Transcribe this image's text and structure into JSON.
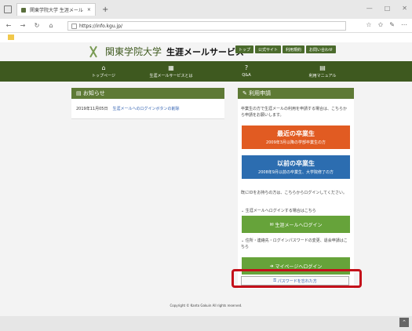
{
  "browser": {
    "tab_title": "関東学院大学 生涯メール",
    "new_tab": "+",
    "url": "https://info.kgu.jp/",
    "controls": [
      "—",
      "□",
      "✕"
    ],
    "right_icons": [
      "☆",
      "✩",
      "✎",
      "⋯"
    ]
  },
  "site": {
    "university": "関東学院大学",
    "service": "生涯メールサービス",
    "top_links": [
      "トップ",
      "公式サイト",
      "利用規約",
      "お問い合わせ"
    ]
  },
  "nav": [
    {
      "icon": "⌂",
      "label": "トップページ"
    },
    {
      "icon": "▦",
      "label": "生涯メールサービスとは"
    },
    {
      "icon": "?",
      "label": "Q&A"
    },
    {
      "icon": "▤",
      "label": "利用マニュアル"
    }
  ],
  "news": {
    "header": "お知らせ",
    "date": "2019年11月05日",
    "item": "生涯メールへのログインボタンの削除"
  },
  "apply": {
    "header": "利用申請",
    "intro": "卒業生の方で生涯メールの利用を申請する場合は、こちらから申請をお願いします。",
    "recent_title": "最近の卒業生",
    "recent_sub": "2009年3月以降の学部卒業生の方",
    "older_title": "以前の卒業生",
    "older_sub": "2008年9月以前の卒業生、大学院修了の方",
    "login_note": "既にIDをお持ちの方は、こちらからログインしてください。",
    "mail_disclosure": "生涯メールへログインする場合はこちら",
    "mail_login": "生涯メールへログイン",
    "mypage_disclosure": "住所・連絡先・ログインパスワードの変更、退会申請はこちら",
    "mypage_login": "マイページへログイン",
    "forgot": "パスワードを忘れた方"
  },
  "footer": "Copyright © Kanto Gakuin All rights reserved."
}
